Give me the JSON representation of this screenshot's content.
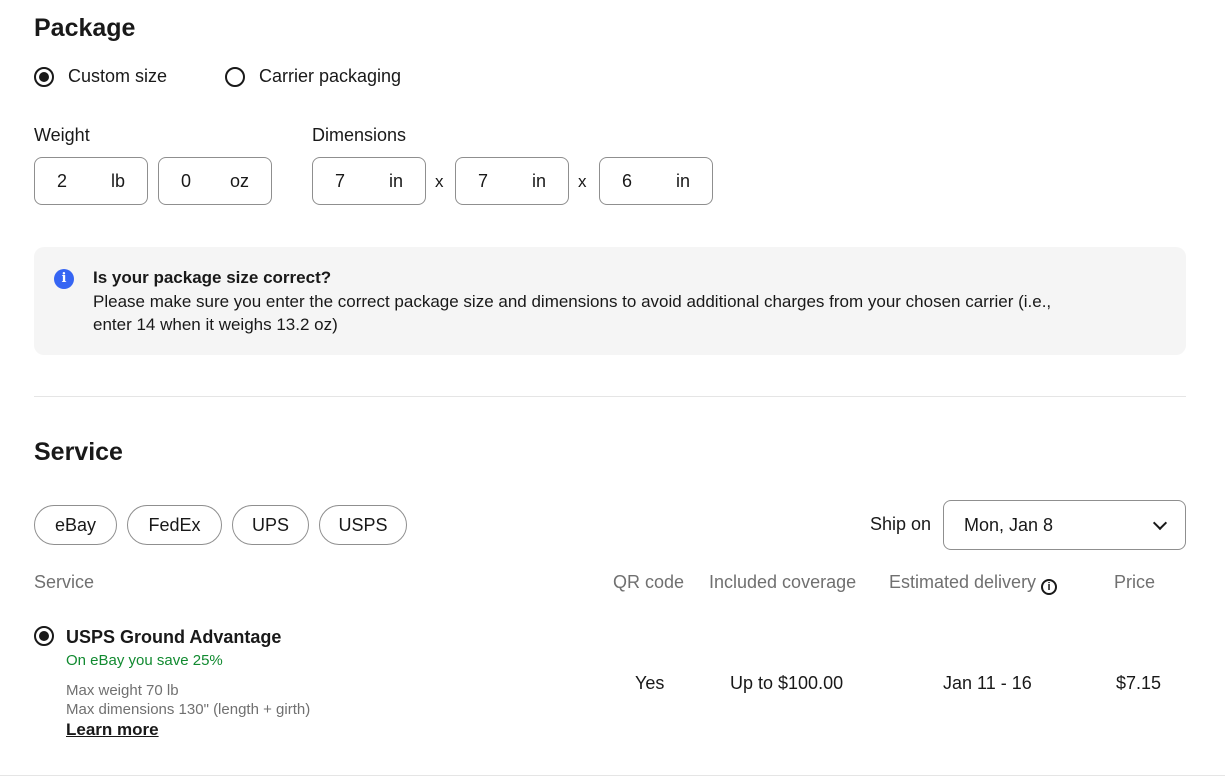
{
  "package": {
    "title": "Package",
    "options": [
      {
        "label": "Custom size",
        "checked": true
      },
      {
        "label": "Carrier packaging",
        "checked": false
      }
    ],
    "weight": {
      "label": "Weight",
      "lb_value": "2",
      "lb_unit": "lb",
      "oz_value": "0",
      "oz_unit": "oz"
    },
    "dimensions": {
      "label": "Dimensions",
      "length": "7",
      "width": "7",
      "height": "6",
      "unit": "in",
      "separator": "x"
    },
    "notice": {
      "icon": "info-icon",
      "title": "Is your package size correct?",
      "body": "Please make sure you enter the correct package size and dimensions to avoid additional charges from your chosen carrier (i.e., enter 14 when it weighs 13.2 oz)"
    }
  },
  "service": {
    "title": "Service",
    "carriers": [
      "eBay",
      "FedEx",
      "UPS",
      "USPS"
    ],
    "ship_on_label": "Ship on",
    "ship_on_value": "Mon, Jan 8",
    "columns": {
      "service": "Service",
      "qr": "QR code",
      "coverage": "Included coverage",
      "delivery": "Estimated delivery",
      "price": "Price"
    },
    "rows": [
      {
        "name": "USPS Ground Advantage",
        "savings": "On eBay you save 25%",
        "max_weight": "Max weight 70 lb",
        "max_dimensions": "Max dimensions 130\" (length + girth)",
        "learn_more": "Learn more",
        "qr": "Yes",
        "coverage": "Up to $100.00",
        "delivery": "Jan 11 - 16",
        "price": "$7.15",
        "selected": true
      }
    ]
  },
  "colors": {
    "accent_blue": "#3665f3",
    "savings_green": "#118a30",
    "muted_text": "#707070"
  }
}
